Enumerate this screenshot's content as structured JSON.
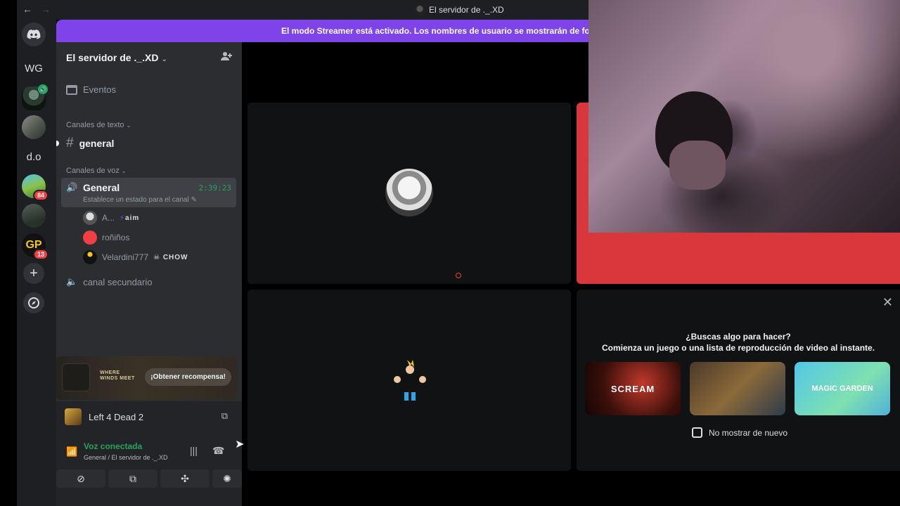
{
  "titlebar": {
    "back": "←",
    "forward": "→",
    "window_title": "El servidor de ._.XD"
  },
  "banner": {
    "text": "El modo Streamer está activado. Los nombres de usuario se mostrarán de forma pa"
  },
  "rail": {
    "home_icon": "discord-logo-icon",
    "wg_label": "WG",
    "do_label": "d.o",
    "badge_bdp": "84",
    "badge_gp": "13",
    "gp_label": "GP",
    "add_icon": "+",
    "discover_icon": "compass-icon"
  },
  "server": {
    "name": "El servidor de ._.XD",
    "chevron": "⌄",
    "invite_icon": "add-member-icon"
  },
  "sidebar": {
    "events": "Eventos",
    "text_category": "Canales de texto",
    "text_channel": "general",
    "voice_category": "Canales de voz",
    "voice_channel": {
      "name": "General",
      "timer": "2:39:23",
      "status": "Establece un estado para el canal"
    },
    "members": [
      {
        "name": "A...",
        "tag": "aim"
      },
      {
        "name": "roñiños",
        "tag": ""
      },
      {
        "name": "Velardini777",
        "tag": "CHOW"
      }
    ],
    "voice_channel_2": "canal secundario"
  },
  "promo": {
    "logo_line1": "WHERE",
    "logo_line2": "WINDS MEET",
    "button": "¡Obtener recompensa!"
  },
  "game": {
    "name": "Left 4 Dead 2"
  },
  "voice": {
    "status": "Voz conectada",
    "location": "General / El servidor de ._.XD"
  },
  "activity": {
    "question": "¿Buscas algo para hacer?",
    "subtitle": "Comienza un juego o una lista de reproducción de video al instante.",
    "cards": [
      "SCREAM",
      "",
      "MAGIC GARDEN"
    ],
    "checkbox_label": "No mostrar de nuevo"
  },
  "colors": {
    "accent": "#7e44ea",
    "connected": "#23a55a",
    "camera_border": "#da373c"
  }
}
